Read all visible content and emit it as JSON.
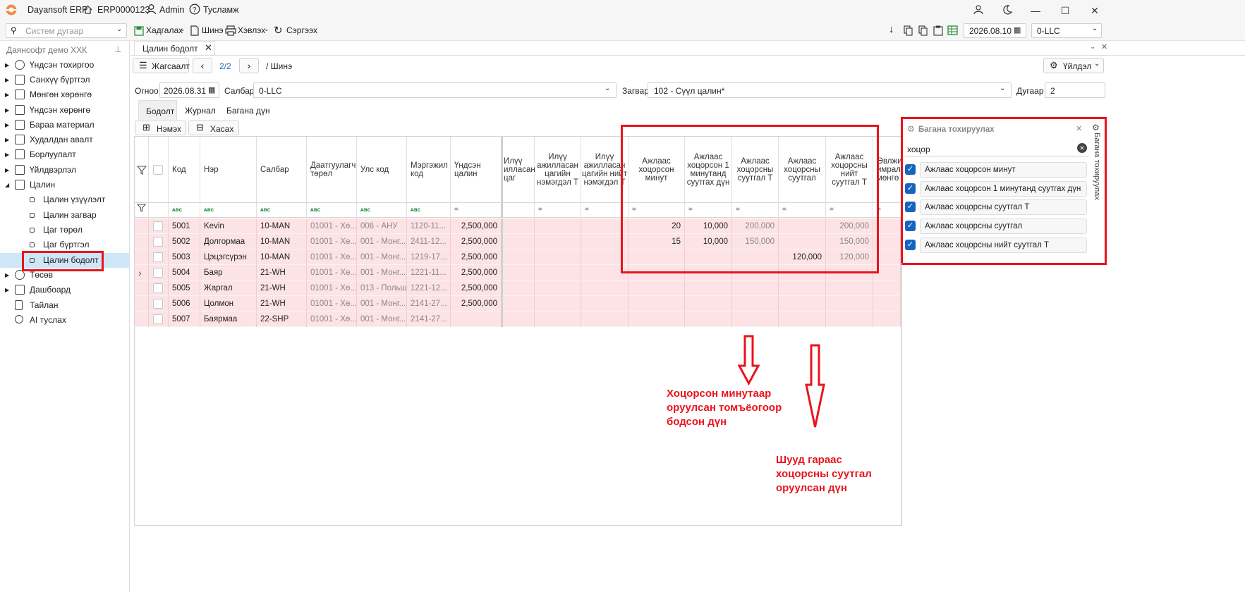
{
  "titlebar": {
    "app_name": "Dayansoft ERP",
    "doc_code": "ERP0000123",
    "user": "Admin",
    "help": "Тусламж"
  },
  "toolbar": {
    "search_placeholder": "Систем дугаар",
    "save": "Хадгалах",
    "new": "Шинэ",
    "print": "Хэвлэх",
    "refresh": "Сэргээх",
    "date": "2026.08.10",
    "branch": "0-LLC"
  },
  "sidebar": {
    "company": "Даянсофт демо ХХК",
    "items": [
      {
        "label": "Үндсэн тохиргоо"
      },
      {
        "label": "Санхүү бүртгэл"
      },
      {
        "label": "Мөнгөн хөрөнгө"
      },
      {
        "label": "Үндсэн хөрөнгө"
      },
      {
        "label": "Бараа материал"
      },
      {
        "label": "Худалдан авалт"
      },
      {
        "label": "Борлуулалт"
      },
      {
        "label": "Үйлдвэрлэл"
      },
      {
        "label": "Цалин"
      },
      {
        "label": "Цалин үзүүлэлт"
      },
      {
        "label": "Цалин загвар"
      },
      {
        "label": "Цаг төрөл"
      },
      {
        "label": "Цаг бүртгэл"
      },
      {
        "label": "Цалин бодолт"
      },
      {
        "label": "Төсөв"
      },
      {
        "label": "Дашбоард"
      },
      {
        "label": "Тайлан"
      },
      {
        "label": "AI туслах"
      }
    ]
  },
  "doc_tab": "Цалин бодолт",
  "nav": {
    "list_button": "Жагсаалт",
    "pager": "2/2",
    "breadcrumb": "/ Шинэ",
    "actions": "Үйлдэл"
  },
  "form": {
    "date_label": "Огноо",
    "date_value": "2026.08.31",
    "branch_label": "Салбар",
    "branch_value": "0-LLC",
    "template_label": "Загвар",
    "template_value": "102 - Сүүл цалин*",
    "number_label": "Дугаар",
    "number_value": "2"
  },
  "subtabs": [
    "Бодолт",
    "Журнал",
    "Багана дүн"
  ],
  "grid_buttons": {
    "add": "Нэмэх",
    "remove": "Хасах"
  },
  "columns": {
    "code": "Код",
    "name": "Нэр",
    "branch": "Салбар",
    "insurer_type": "Даатгуулагч төрөл",
    "country": "Улс код",
    "profession": "Мэргэжил код",
    "base_salary": "Үндсэн цалин",
    "ot_hours": "Илүү илласан цаг",
    "ot_add": "Илүү ажилласан цагийн нэмэгдэл Т",
    "ot_total": "Илүү ажилласан цагийн нийт нэмэгдэл Т",
    "late_min": "Ажлаас хоцорсон минут",
    "late_per_min": "Ажлаас хоцорсон 1 минутанд суутгах дүн",
    "late_deduct_t": "Ажлаас хоцорсны суутгал Т",
    "late_deduct": "Ажлаас хоцорсны суутгал",
    "late_total": "Ажлаас хоцорсны нийт суутгал Т",
    "holiday": "Өвлжи имралт мөнгө"
  },
  "rows": [
    {
      "code": "5001",
      "name": "Kevin",
      "branch": "10-MAN",
      "insurer": "01001 - Хө...",
      "country": "006 - АНУ",
      "prof": "1120-11...",
      "base": "2,500,000",
      "late_min": "20",
      "per_min": "10,000",
      "deduct_t": "200,000",
      "deduct": "",
      "total": "200,000"
    },
    {
      "code": "5002",
      "name": "Долгормаа",
      "branch": "10-MAN",
      "insurer": "01001 - Хө...",
      "country": "001 - Монг...",
      "prof": "2411-12...",
      "base": "2,500,000",
      "late_min": "15",
      "per_min": "10,000",
      "deduct_t": "150,000",
      "deduct": "",
      "total": "150,000"
    },
    {
      "code": "5003",
      "name": "Цэцэгсүрэн",
      "branch": "10-MAN",
      "insurer": "01001 - Хө...",
      "country": "001 - Монг...",
      "prof": "1219-17...",
      "base": "2,500,000",
      "late_min": "",
      "per_min": "",
      "deduct_t": "",
      "deduct": "120,000",
      "total": "120,000"
    },
    {
      "code": "5004",
      "name": "Баяр",
      "branch": "21-WH",
      "insurer": "01001 - Хө...",
      "country": "001 - Монг...",
      "prof": "1221-11...",
      "base": "2,500,000",
      "late_min": "",
      "per_min": "",
      "deduct_t": "",
      "deduct": "",
      "total": ""
    },
    {
      "code": "5005",
      "name": "Жаргал",
      "branch": "21-WH",
      "insurer": "01001 - Хө...",
      "country": "013 - Польш",
      "prof": "1221-12...",
      "base": "2,500,000",
      "late_min": "",
      "per_min": "",
      "deduct_t": "",
      "deduct": "",
      "total": ""
    },
    {
      "code": "5006",
      "name": "Цолмон",
      "branch": "21-WH",
      "insurer": "01001 - Хө...",
      "country": "001 - Монг...",
      "prof": "2141-27...",
      "base": "2,500,000",
      "late_min": "",
      "per_min": "",
      "deduct_t": "",
      "deduct": "",
      "total": ""
    },
    {
      "code": "5007",
      "name": "Баярмаа",
      "branch": "22-SHP",
      "insurer": "01001 - Хө...",
      "country": "001 - Монг...",
      "prof": "2141-27...",
      "base": "",
      "late_min": "",
      "per_min": "",
      "deduct_t": "",
      "deduct": "",
      "total": ""
    }
  ],
  "column_panel": {
    "title": "Багана тохируулах",
    "search": "хоцор",
    "side_tab": "Багана тохируулах",
    "items": [
      "Ажлаас хоцорсон минут",
      "Ажлаас хоцорсон 1 минутанд суутгах дүн",
      "Ажлаас хоцорсны суутгал Т",
      "Ажлаас хоцорсны суутгал",
      "Ажлаас хоцорсны нийт суутгал Т"
    ]
  },
  "annotations": {
    "note1_l1": "Хоцорсон минутаар",
    "note1_l2": "оруулсан томъёогоор",
    "note1_l3": "бодсон дүн",
    "note2_l1": "Шууд гараас",
    "note2_l2": "хоцорсны суутгал",
    "note2_l3": "оруулсан дүн",
    "color": "#e8141e"
  }
}
